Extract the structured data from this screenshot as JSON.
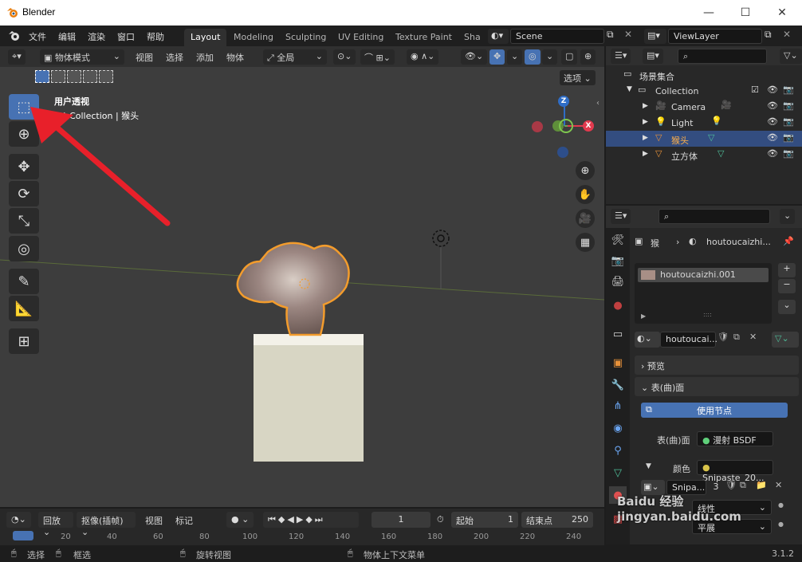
{
  "titlebar": {
    "app_title": "Blender",
    "minimize": "—",
    "maximize": "☐",
    "close": "✕"
  },
  "menu": {
    "file": "文件",
    "edit": "编辑",
    "render": "渲染",
    "window": "窗口",
    "help": "帮助"
  },
  "workspaces": [
    "Layout",
    "Modeling",
    "Sculpting",
    "UV Editing",
    "Texture Paint",
    "Sha"
  ],
  "scene_field": "Scene",
  "viewlayer_field": "ViewLayer",
  "viewport": {
    "mode": "物体模式",
    "menu_view": "视图",
    "menu_select": "选择",
    "menu_add": "添加",
    "menu_object": "物体",
    "transform_orientation": "全局",
    "options_button": "选项",
    "overlay_title": "用户透视",
    "overlay_collection": "(1) Collection | 猴头",
    "gizmo_z": "Z",
    "gizmo_x": "X"
  },
  "outliner": {
    "scene_collection": "场景集合",
    "items": [
      {
        "label": "Collection"
      },
      {
        "label": "Camera"
      },
      {
        "label": "Light"
      },
      {
        "label": "猴头"
      },
      {
        "label": "立方体"
      }
    ]
  },
  "properties": {
    "breadcrumb_object": "猴",
    "breadcrumb_material": "houtoucaizhi...",
    "material_slot": "houtoucaizhi.001",
    "material_name_field": "houtoucai...",
    "preview_panel": "预览",
    "surface_panel": "表(曲)面",
    "use_nodes_button": "使用节点",
    "surface_label": "表(曲)面",
    "surface_value": "漫射 BSDF",
    "color_label": "颜色",
    "color_value": "Snipaste_20...",
    "image_field": "Snipa...",
    "user_count": "3",
    "row_label_1": "线性",
    "row_label_2": "平展"
  },
  "timeline": {
    "playback": "回放",
    "keying": "抠像(插帧)",
    "view": "视图",
    "marker": "标记",
    "current_frame": "1",
    "start_label": "起始",
    "start_value": "1",
    "end_label": "结束点",
    "end_value": "250",
    "ruler": [
      "0",
      "20",
      "40",
      "60",
      "80",
      "100",
      "120",
      "140",
      "160",
      "180",
      "200",
      "220",
      "240"
    ]
  },
  "statusbar": {
    "select": "选择",
    "box_select": "框选",
    "rotate_view": "旋转视图",
    "context_menu": "物体上下文菜单",
    "version": "3.1.2"
  },
  "watermark": "Baidu 经验 jingyan.baidu.com",
  "colors": {
    "accent": "#4772b3",
    "selection": "#334d80",
    "arrow": "#e8202a",
    "outline": "#f39c2c"
  }
}
